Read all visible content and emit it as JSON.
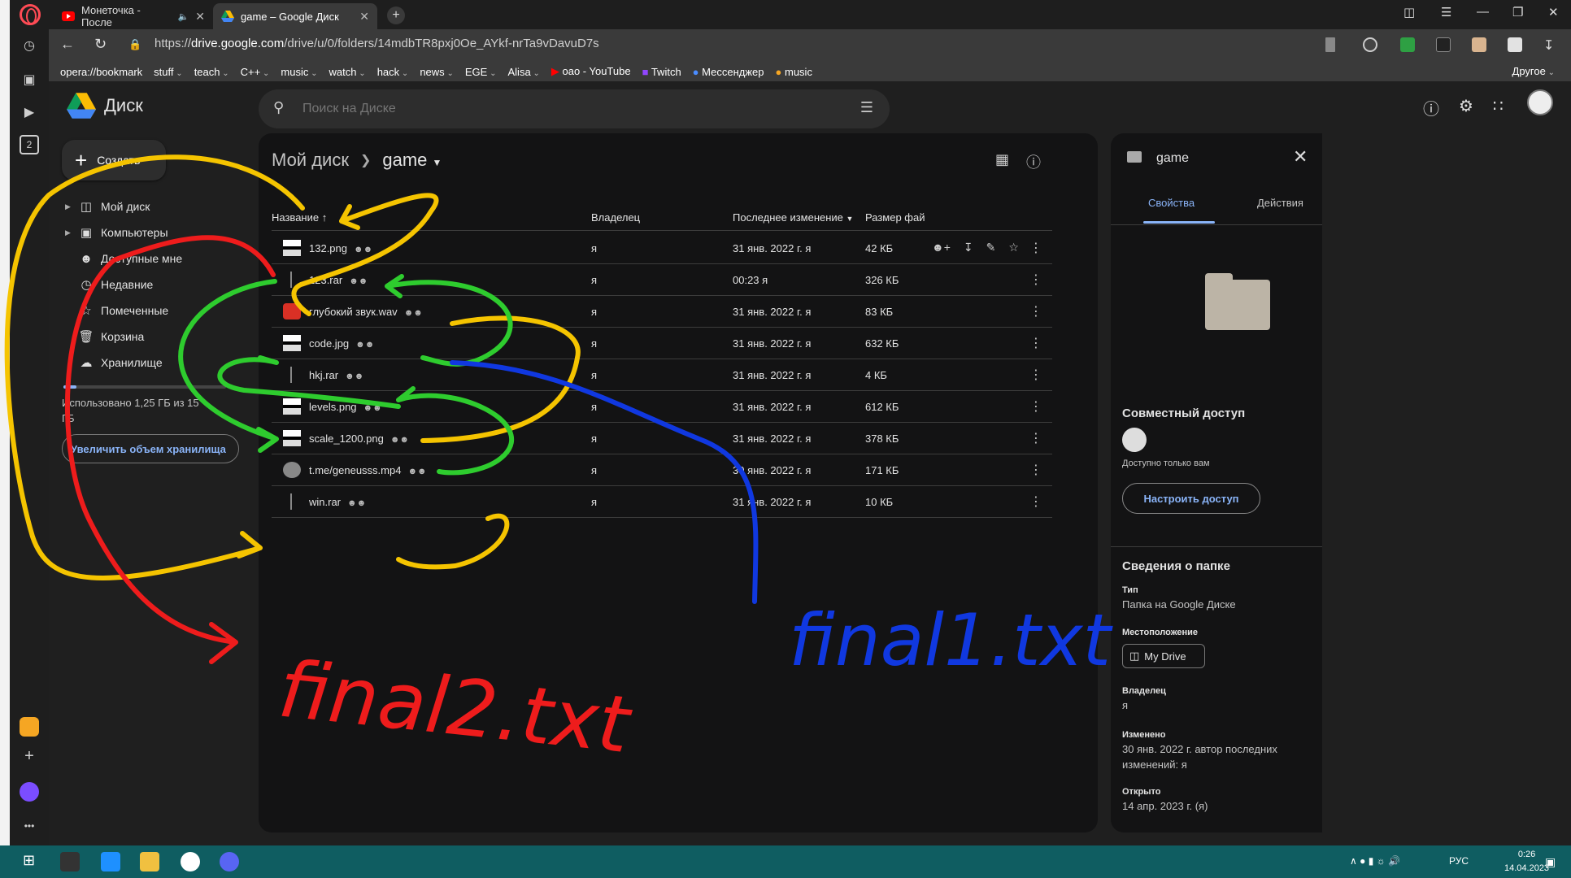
{
  "browser": {
    "tabs": [
      {
        "title": "Монеточка - После",
        "active": false
      },
      {
        "title": "game – Google Диск",
        "active": true
      }
    ],
    "url_prefix": "https://",
    "url_domain": "drive.google.com",
    "url_path": "/drive/u/0/folders/14mdbTR8pxj0Oe_AYkf-nrTa9vDavuD7s",
    "bookmarks": [
      {
        "label": "opera://bookmark",
        "dropdown": false
      },
      {
        "label": "stuff",
        "dropdown": true
      },
      {
        "label": "teach",
        "dropdown": true
      },
      {
        "label": "C++",
        "dropdown": true
      },
      {
        "label": "music",
        "dropdown": true
      },
      {
        "label": "watch",
        "dropdown": true
      },
      {
        "label": "hack",
        "dropdown": true
      },
      {
        "label": "news",
        "dropdown": true
      },
      {
        "label": "EGE",
        "dropdown": true
      },
      {
        "label": "Alisa",
        "dropdown": true
      },
      {
        "label": "oao - YouTube",
        "dropdown": false
      },
      {
        "label": "Twitch",
        "dropdown": false
      },
      {
        "label": "Мессенджер",
        "dropdown": false
      },
      {
        "label": "music",
        "dropdown": false
      }
    ],
    "bookmarks_other": "Другое",
    "sidebar_badge": "2"
  },
  "drive": {
    "app_name": "Диск",
    "search_placeholder": "Поиск на Диске",
    "create_label": "Создать",
    "nav": [
      {
        "label": "Мой диск",
        "icon": "drive-icon",
        "caret": true
      },
      {
        "label": "Компьютеры",
        "icon": "computers-icon",
        "caret": true
      },
      {
        "label": "Доступные мне",
        "icon": "shared-icon",
        "caret": false
      },
      {
        "label": "Недавние",
        "icon": "clock-icon",
        "caret": false
      },
      {
        "label": "Помеченные",
        "icon": "star-icon",
        "caret": false
      },
      {
        "label": "Корзина",
        "icon": "trash-icon",
        "caret": false
      },
      {
        "label": "Хранилище",
        "icon": "cloud-icon",
        "caret": false
      }
    ],
    "storage_text": "Использовано 1,25 ГБ из 15 ГБ",
    "storage_fraction": 0.08,
    "upgrade_label": "Увеличить объем хранилища"
  },
  "main": {
    "breadcrumb_root": "Мой диск",
    "breadcrumb_current": "game",
    "columns": {
      "name": "Название",
      "owner": "Владелец",
      "modified": "Последнее изменение",
      "size": "Размер фай"
    },
    "files": [
      {
        "name": "132.png",
        "owner": "я",
        "modified": "31 янв. 2022 г. я",
        "size": "42 КБ",
        "type": "image"
      },
      {
        "name": "123.rar",
        "owner": "я",
        "modified": "00:23 я",
        "size": "326 КБ",
        "type": "archive"
      },
      {
        "name": "глубокий звук.wav",
        "owner": "я",
        "modified": "31 янв. 2022 г. я",
        "size": "83 КБ",
        "type": "audio"
      },
      {
        "name": "code.jpg",
        "owner": "я",
        "modified": "31 янв. 2022 г. я",
        "size": "632 КБ",
        "type": "image"
      },
      {
        "name": "hkj.rar",
        "owner": "я",
        "modified": "31 янв. 2022 г. я",
        "size": "4 КБ",
        "type": "archive"
      },
      {
        "name": "levels.png",
        "owner": "я",
        "modified": "31 янв. 2022 г. я",
        "size": "612 КБ",
        "type": "image"
      },
      {
        "name": "scale_1200.png",
        "owner": "я",
        "modified": "31 янв. 2022 г. я",
        "size": "378 КБ",
        "type": "image"
      },
      {
        "name": "t.me/geneusss.mp4",
        "owner": "я",
        "modified": "30 янв. 2022 г. я",
        "size": "171 КБ",
        "type": "video"
      },
      {
        "name": "win.rar",
        "owner": "я",
        "modified": "31 янв. 2022 г. я",
        "size": "10 КБ",
        "type": "archive"
      }
    ]
  },
  "details": {
    "title": "game",
    "tab_props": "Свойства",
    "tab_actions": "Действия",
    "shared_heading": "Совместный доступ",
    "shared_note": "Доступно только вам",
    "access_button": "Настроить доступ",
    "info_heading": "Сведения о папке",
    "type_label": "Тип",
    "type_value": "Папка на Google Диске",
    "location_label": "Местоположение",
    "location_value": "My Drive",
    "owner_label": "Владелец",
    "owner_value": "я",
    "modified_label": "Изменено",
    "modified_value": "30 янв. 2022 г. автор последних изменений: я",
    "opened_label": "Открыто",
    "opened_value": "14 апр. 2023 г. (я)"
  },
  "annotations": {
    "red": "final2.txt",
    "blue": "final1.txt"
  },
  "taskbar": {
    "lang": "РУС",
    "time": "0:26",
    "date": "14.04.2023"
  }
}
